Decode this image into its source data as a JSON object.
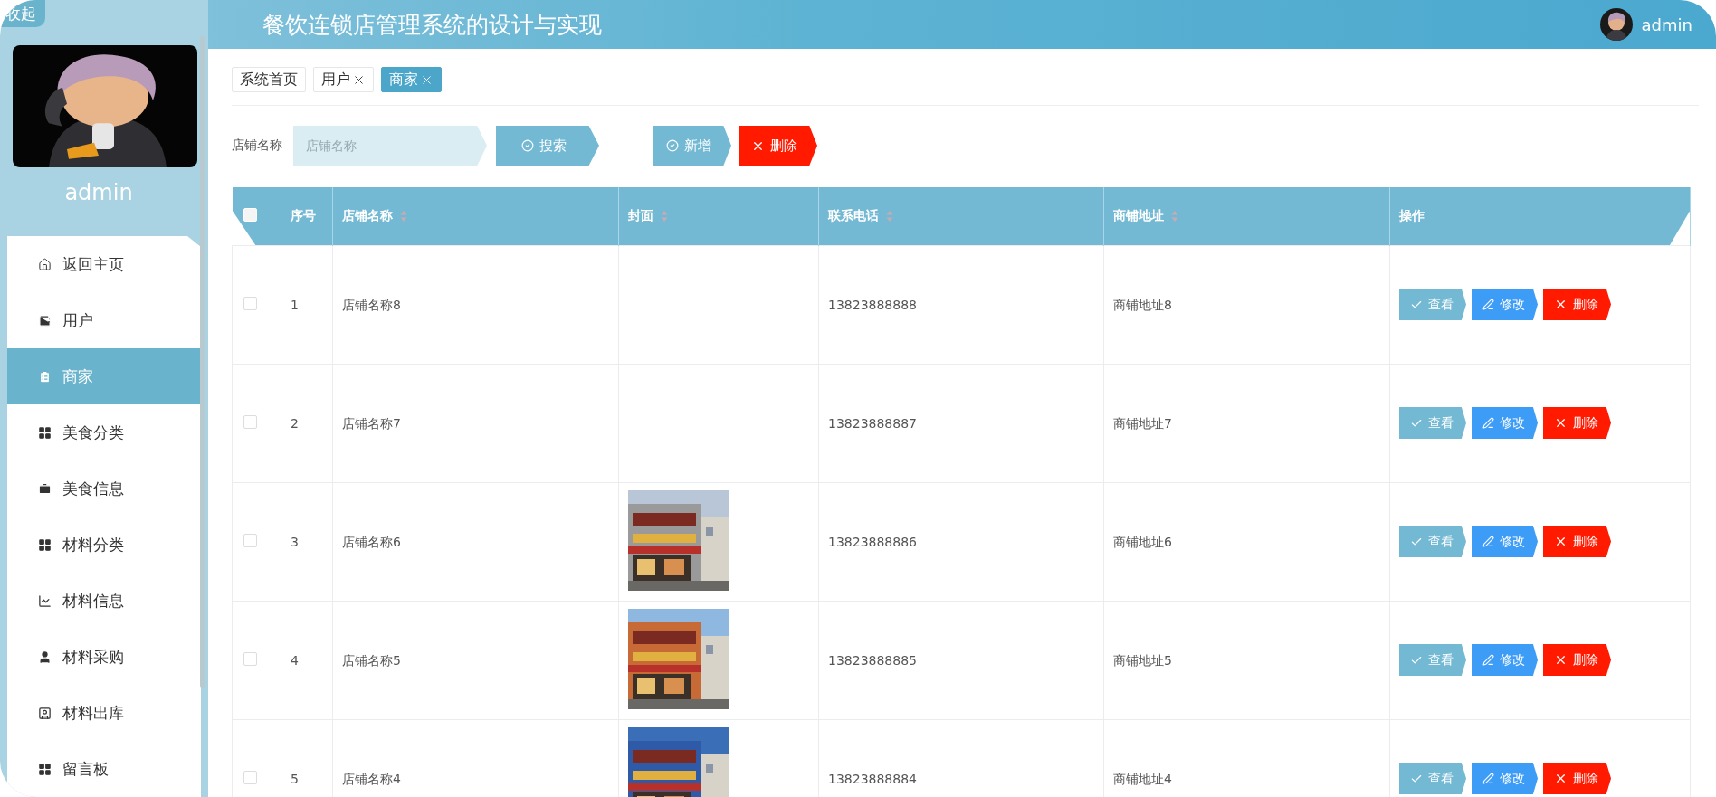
{
  "sidebar": {
    "collapse_label": "收起",
    "username": "admin",
    "menu": [
      {
        "label": "返回主页",
        "selected": false
      },
      {
        "label": "用户",
        "selected": false
      },
      {
        "label": "商家",
        "selected": true
      },
      {
        "label": "美食分类",
        "selected": false
      },
      {
        "label": "美食信息",
        "selected": false
      },
      {
        "label": "材料分类",
        "selected": false
      },
      {
        "label": "材料信息",
        "selected": false
      },
      {
        "label": "材料采购",
        "selected": false
      },
      {
        "label": "材料出库",
        "selected": false
      },
      {
        "label": "留言板",
        "selected": false
      }
    ]
  },
  "header": {
    "title": "餐饮连锁店管理系统的设计与实现",
    "user": "admin"
  },
  "tags": [
    {
      "label": "系统首页",
      "closable": false,
      "selected": false
    },
    {
      "label": "用户",
      "closable": true,
      "selected": false
    },
    {
      "label": "商家",
      "closable": true,
      "selected": true
    }
  ],
  "search": {
    "label": "店铺名称",
    "placeholder": "店铺名称",
    "button": "搜索"
  },
  "actions": [
    {
      "label": "新增",
      "kind": "add"
    },
    {
      "label": "删除",
      "kind": "delete"
    }
  ],
  "table": {
    "all_checked": false,
    "columns": [
      {
        "label": "序号",
        "sortable": false
      },
      {
        "label": "店铺名称",
        "sortable": true
      },
      {
        "label": "封面",
        "sortable": true
      },
      {
        "label": "联系电话",
        "sortable": true
      },
      {
        "label": "商铺地址",
        "sortable": true
      },
      {
        "label": "操作",
        "sortable": false
      }
    ],
    "rows": [
      {
        "checked": false,
        "index": "1",
        "name": "店铺名称8",
        "cover_loaded": false,
        "phone": "13823888888",
        "address": "商铺地址8",
        "actions": [
          {
            "label": "查看",
            "kind": "view"
          },
          {
            "label": "修改",
            "kind": "edit"
          },
          {
            "label": "删除",
            "kind": "delete"
          }
        ]
      },
      {
        "checked": false,
        "index": "2",
        "name": "店铺名称7",
        "cover_loaded": false,
        "phone": "13823888887",
        "address": "商铺地址7",
        "actions": [
          {
            "label": "查看",
            "kind": "view"
          },
          {
            "label": "修改",
            "kind": "edit"
          },
          {
            "label": "删除",
            "kind": "delete"
          }
        ]
      },
      {
        "checked": false,
        "index": "3",
        "name": "店铺名称6",
        "cover_loaded": true,
        "phone": "13823888886",
        "address": "商铺地址6",
        "actions": [
          {
            "label": "查看",
            "kind": "view"
          },
          {
            "label": "修改",
            "kind": "edit"
          },
          {
            "label": "删除",
            "kind": "delete"
          }
        ]
      },
      {
        "checked": false,
        "index": "4",
        "name": "店铺名称5",
        "cover_loaded": true,
        "phone": "13823888885",
        "address": "商铺地址5",
        "actions": [
          {
            "label": "查看",
            "kind": "view"
          },
          {
            "label": "修改",
            "kind": "edit"
          },
          {
            "label": "删除",
            "kind": "delete"
          }
        ]
      },
      {
        "checked": false,
        "index": "5",
        "name": "店铺名称4",
        "cover_loaded": true,
        "phone": "13823888884",
        "address": "商铺地址4",
        "actions": [
          {
            "label": "查看",
            "kind": "view"
          },
          {
            "label": "修改",
            "kind": "edit"
          },
          {
            "label": "删除",
            "kind": "delete"
          }
        ]
      }
    ]
  }
}
